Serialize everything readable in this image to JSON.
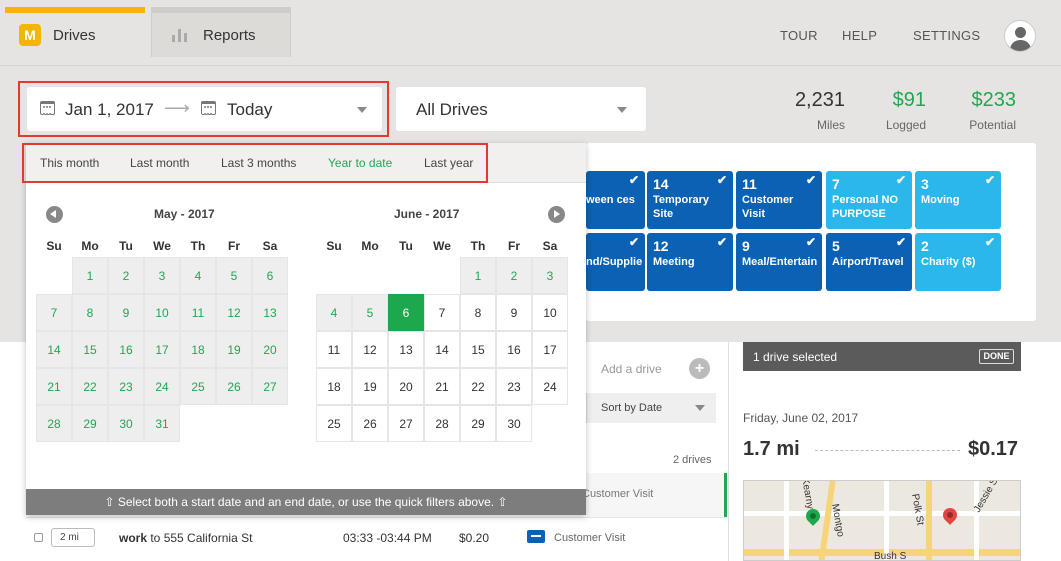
{
  "header": {
    "tabs": [
      {
        "label": "Drives",
        "active": true
      },
      {
        "label": "Reports",
        "active": false
      }
    ],
    "nav": [
      "TOUR",
      "HELP",
      "SETTINGS"
    ],
    "logo_glyph": "M"
  },
  "filters": {
    "start_date": "Jan 1, 2017",
    "end_date": "Today",
    "drives_filter": "All Drives"
  },
  "stats": [
    {
      "value": "2,231",
      "label": "Miles",
      "color": "#333333"
    },
    {
      "value": "$91",
      "label": "Logged",
      "color": "#22a651"
    },
    {
      "value": "$233",
      "label": "Potential",
      "color": "#22a651"
    }
  ],
  "purposes": [
    {
      "count": "",
      "name": "ween ces",
      "style": "dark"
    },
    {
      "count": "14",
      "name": "Temporary Site",
      "style": "dark"
    },
    {
      "count": "11",
      "name": "Customer Visit",
      "style": "dark"
    },
    {
      "count": "7",
      "name": "Personal NO PURPOSE",
      "style": "light"
    },
    {
      "count": "3",
      "name": "Moving",
      "style": "light"
    },
    {
      "count": "",
      "name": "nd/Supplie",
      "style": "dark"
    },
    {
      "count": "12",
      "name": "Meeting",
      "style": "dark"
    },
    {
      "count": "9",
      "name": "Meal/Entertain",
      "style": "dark"
    },
    {
      "count": "5",
      "name": "Airport/Travel",
      "style": "dark"
    },
    {
      "count": "2",
      "name": "Charity ($)",
      "style": "light"
    }
  ],
  "quick_filters": [
    {
      "label": "This month",
      "active": false
    },
    {
      "label": "Last month",
      "active": false
    },
    {
      "label": "Last 3 months",
      "active": false
    },
    {
      "label": "Year to date",
      "active": true
    },
    {
      "label": "Last year",
      "active": false
    }
  ],
  "calendar": {
    "weekdays": [
      "Su",
      "Mo",
      "Tu",
      "We",
      "Th",
      "Fr",
      "Sa"
    ],
    "months": [
      {
        "title": "May - 2017",
        "first_weekday": 1,
        "days": 31,
        "in_range_through": 31,
        "selected": null
      },
      {
        "title": "June - 2017",
        "first_weekday": 4,
        "days": 30,
        "in_range_through": 5,
        "selected": 6
      }
    ],
    "hint": "⇧ Select both a start date and an end date, or use the quick filters above. ⇧"
  },
  "list": {
    "add_drive": "Add a drive",
    "sort": "Sort by Date",
    "count": "2 drives",
    "partial_purpose": "Customer Visit",
    "row": {
      "miles": "2 mi",
      "purpose_word": "work",
      "destination": " to 555 California St",
      "time": "03:33 -03:44 PM",
      "amount": "$0.20",
      "purpose": "Customer Visit"
    }
  },
  "side": {
    "selected": "1 drive selected",
    "done": "DONE",
    "date": "Friday, June 02, 2017",
    "distance": "1.7 mi",
    "amount": "$0.17",
    "map_labels": [
      "Kearny St",
      "Montgo",
      "Polk St",
      "Jessie St",
      "Bush S"
    ]
  }
}
